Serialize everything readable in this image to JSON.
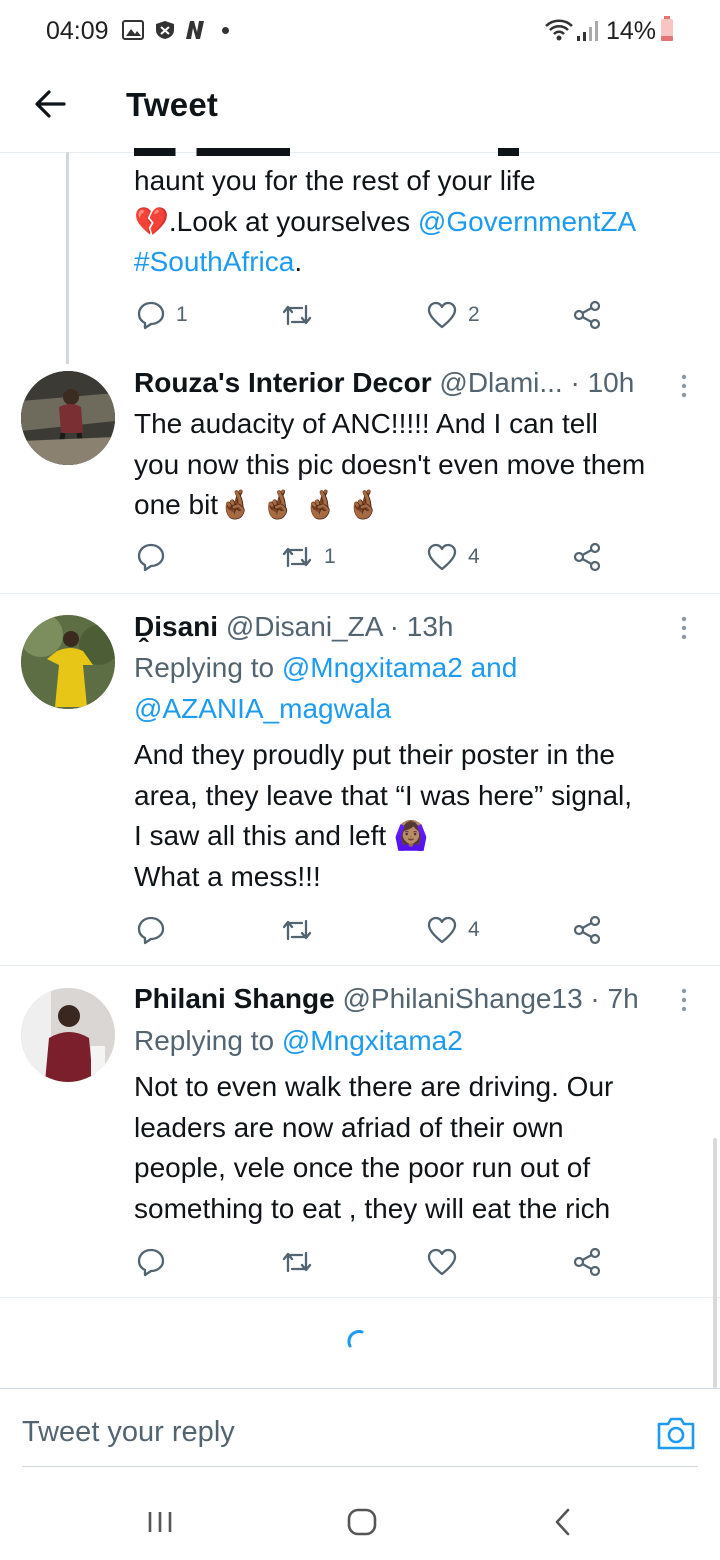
{
  "status": {
    "time": "04:09",
    "battery": "14%"
  },
  "header": {
    "title": "Tweet"
  },
  "tweet0": {
    "line1": "haunt you for the rest of your life",
    "heart_emoji": "💔",
    "line2_text": ".Look at yourselves ",
    "line2_mention": "@GovernmentZA",
    "line3_hashtag": "#SouthAfrica",
    "line3_suffix": ".",
    "reply_count": "1",
    "retweet_count": "",
    "like_count": "2"
  },
  "tweet1": {
    "name": "Rouza's Interior Decor",
    "handle": "@Dlami...",
    "sep": " · ",
    "time": "10h",
    "line1": "The audacity of ANC!!!!! And I can tell",
    "line2": "you now this pic doesn't even move them",
    "line3_text": "one bit",
    "line3_emoji": "🤞🏾 🤞🏾 🤞🏾 🤞🏾",
    "reply_count": "",
    "retweet_count": "1",
    "like_count": "4"
  },
  "tweet2": {
    "name": "Ḓisani",
    "handle": "@Disani_ZA",
    "sep": " · ",
    "time": "13h",
    "replying_prefix": "Replying to ",
    "replying_mention1": "@Mngxitama2",
    "replying_and": " and",
    "replying_mention2": "@AZANIA_magwala",
    "line1": "And they proudly put their poster in the",
    "line2": "area, they leave that “I was here” signal,",
    "line3_text": "I saw all this and left ",
    "line3_emoji": "🙆🏽‍♀️",
    "line4": "What a mess!!!",
    "like_count": "4"
  },
  "tweet3": {
    "name": "Philani Shange",
    "handle": "@PhilaniShange13",
    "sep": " · ",
    "time": "7h",
    "replying_prefix": "Replying to ",
    "replying_mention1": "@Mngxitama2",
    "line1": "Not to even walk there are driving. Our",
    "line2": "leaders are now afriad of their own",
    "line3": "people, vele once the poor run out of",
    "line4": "something to eat , they will eat the rich"
  },
  "reply": {
    "placeholder": "Tweet your reply"
  },
  "colors": {
    "link": "#1d9bf0",
    "muted": "#536471",
    "divider": "#e6ecf0"
  }
}
